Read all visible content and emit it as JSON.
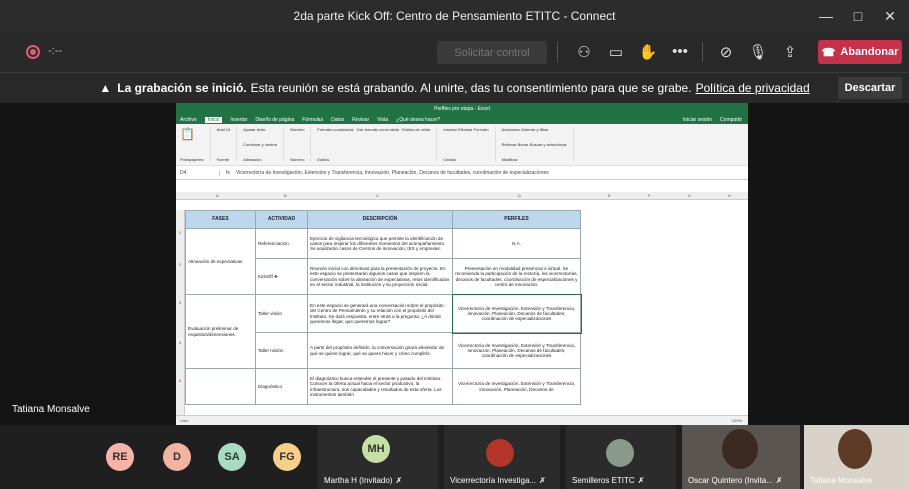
{
  "window": {
    "title": "2da parte Kick Off: Centro de Pensamiento ETITC - Connect",
    "controls": [
      "—",
      "□",
      "✕"
    ]
  },
  "toolbar": {
    "timer": "-:--",
    "request_control": "Solicitar control",
    "leave": "Abandonar",
    "icons": [
      "participants-icon",
      "chat-icon",
      "raise-hand-icon",
      "more-icon",
      "camera-off-icon",
      "mic-off-icon",
      "share-icon",
      "phone-icon"
    ]
  },
  "banner": {
    "warning": "▲",
    "bold": "La grabación se inició.",
    "text": "Esta reunión se está grabando. Al unirte, das tu consentimiento para que se grabe.",
    "link": "Política de privacidad",
    "discard": "Descartar"
  },
  "excel": {
    "title": "Perfiles por etapa - Excel",
    "account": "Iniciar sesión",
    "share": "Compartir",
    "menu": [
      "Archivo",
      "Inicio",
      "Insertar",
      "Diseño de página",
      "Fórmulas",
      "Datos",
      "Revisar",
      "Vista",
      "¿Qué desea hacer?"
    ],
    "ribbon_groups": [
      "Portapapeles",
      "Fuente",
      "Alineación",
      "Número",
      "Estilos",
      "Celdas",
      "Modificar"
    ],
    "ribbon_labels": {
      "font": "Arial",
      "size": "10",
      "wrap": "Ajustar texto",
      "merge": "Combinar y centrar",
      "number_format": "Número",
      "conditional": "Formato condicional",
      "as_table": "Dar formato como tabla",
      "cell_styles": "Estilos de celda",
      "insert": "Insertar",
      "delete": "Eliminar",
      "format": "Formato",
      "autosum": "Autosuma",
      "fill": "Rellenar",
      "clear": "Borrar",
      "sort": "Ordenar y filtrar",
      "find": "Buscar y seleccionar"
    },
    "cell_ref": "D4",
    "formula": "Vicerrectoría de Investigación, Extensión y Transferencia, Innovación,  Planeación, Decanos de facultades, coordinación de especializaciones",
    "columns": [
      "A",
      "B",
      "C",
      "D",
      "E",
      "F",
      "G",
      "H",
      "I"
    ],
    "headers": [
      "FASES",
      "ACTIVIDAD",
      "DESCRIPCIÓN",
      "PERFILES"
    ],
    "rows": [
      {
        "num": "1",
        "fase": "",
        "actividad": "Referenciación",
        "descripcion": "Ejercicio de vigilancia tecnológica que permite la identificación de casos para inspirar los diferentes momentos del acompañamiento. Se analizarán casos de Centros de innovación, IES y empresas.",
        "perfiles": "N.A."
      },
      {
        "num": "2",
        "fase": "Alineación de expectativas",
        "actividad": "KickOff",
        "descripcion": "Reunión inicial con directivas para la presentación de proyecto. En este espacio se presentarán algunos casos que inspiren la conversación sobre la alineación de expectativas, retos identificados en el sector industrial, la institución y su proyección social.",
        "perfiles": "Presentación en modalidad presencial o virtual. Se recomienda la participación de la rectoría, los vicerrectorías, decanos de facultades, coordinación de especializaciones y centro de innovación."
      },
      {
        "num": "3",
        "fase": "",
        "actividad": "Taller visión",
        "descripcion": "En este espacio se generará una conversación sobre el propósito del Centro de Pensamiento y su relación con el propósito del Instituto. Se dará respuesta, entre otras a la pregunta: ¿A dónde queremos llegar, que queremos lograr?",
        "perfiles": "Vicerrectoría de Investigación, Extensión y Transferencia, innovación,  Planeación, Decanos de facultades, coordinación de especializaciones"
      },
      {
        "num": "4",
        "fase": "Evaluación preliminar de requisitos/dimensiones",
        "actividad": "Taller misión",
        "descripcion": "A partir del propósito definido, la conversación girará alrededor de qué se quiere lograr, qué se quiere hacer y cómo cumplirlo.",
        "perfiles": "Vicerrectoría de Investigación, Extensión y Transferencia, innovación,  Planeación, Decanos de facultades, coordinación de especializaciones"
      },
      {
        "num": "5",
        "fase": "",
        "actividad": "Diagnóstico",
        "descripcion": "El diagnóstico busca entender el presente y pasado del Instituto. Conocer la Oferta actual hacia el sector productivo, la infraestructura, sus capacidades y resultados de esta oferta. Los instrumentos también",
        "perfiles": "Vicerrectoría de Investigación, Extensión y Transferencia, innovación,  Planeación, Decanos de"
      }
    ],
    "status": "Listo",
    "zoom": "100%"
  },
  "presenter_name": "Tatiana Monsalve",
  "participants": [
    {
      "initials": "RE",
      "color": "#f4b4a8"
    },
    {
      "initials": "D",
      "color": "#f2b4a0"
    },
    {
      "initials": "SA",
      "color": "#a8dcc0"
    },
    {
      "initials": "FG",
      "color": "#f6d08a"
    }
  ],
  "tiles": [
    {
      "initials": "MH",
      "color": "#c5e0a5",
      "name": "Martha H (Invitado)"
    },
    {
      "name": "Vicerrectoría Investiga..."
    },
    {
      "name": "Semilleros ETITC"
    },
    {
      "name": "Oscar Quintero (Invita..."
    },
    {
      "name": "Tatiana Monsalve"
    }
  ]
}
